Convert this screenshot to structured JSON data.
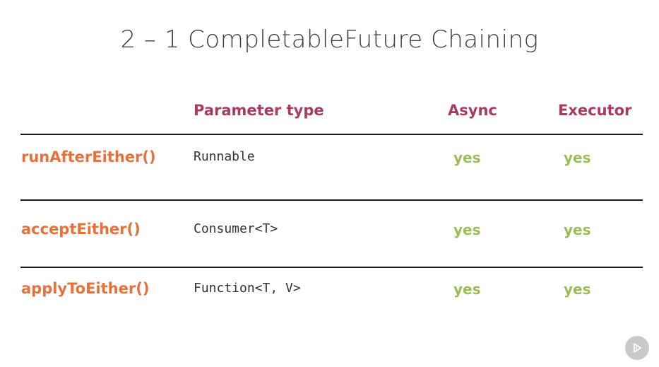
{
  "title": "2 – 1  CompletableFuture Chaining",
  "table": {
    "headers": {
      "param_type": "Parameter type",
      "async": "Async",
      "executor": "Executor"
    },
    "rows": [
      {
        "method": "runAfterEither()",
        "param_type": "Runnable",
        "async": "yes",
        "executor": "yes"
      },
      {
        "method": "acceptEither()",
        "param_type": "Consumer<T>",
        "async": "yes",
        "executor": "yes"
      },
      {
        "method": "applyToEither()",
        "param_type": "Function<T, V>",
        "async": "yes",
        "executor": "yes"
      }
    ]
  },
  "icons": {
    "play": "play-icon"
  },
  "colors": {
    "title": "#404040",
    "header": "#a63d61",
    "method": "#e8703a",
    "yes": "#9cbd56",
    "rule": "#1a1a1a"
  }
}
